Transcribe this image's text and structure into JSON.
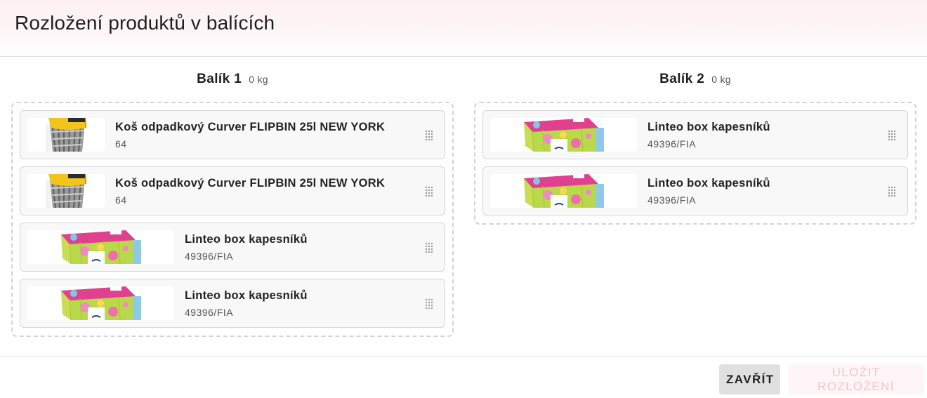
{
  "dialog": {
    "title": "Rozložení produktů v balících"
  },
  "packages": [
    {
      "name": "Balík 1",
      "weight": "0 kg",
      "items": [
        {
          "name": "Koš odpadkový Curver FLIPBIN 25l NEW YORK",
          "code": "64",
          "image": "trash-bin-image"
        },
        {
          "name": "Koš odpadkový Curver FLIPBIN 25l NEW YORK",
          "code": "64",
          "image": "trash-bin-image"
        },
        {
          "name": "Linteo box kapesníků",
          "code": "49396/FIA",
          "image": "tissue-box-image"
        },
        {
          "name": "Linteo box kapesníků",
          "code": "49396/FIA",
          "image": "tissue-box-image"
        }
      ]
    },
    {
      "name": "Balík 2",
      "weight": "0 kg",
      "items": [
        {
          "name": "Linteo box kapesníků",
          "code": "49396/FIA",
          "image": "tissue-box-image"
        },
        {
          "name": "Linteo box kapesníků",
          "code": "49396/FIA",
          "image": "tissue-box-image"
        }
      ]
    }
  ],
  "footer": {
    "close_label": "Zavřít",
    "save_label": "Uložit rozložení"
  },
  "colors": {
    "header_tint": "#fdf0f3",
    "disabled_accent": "#f6c3d0"
  }
}
